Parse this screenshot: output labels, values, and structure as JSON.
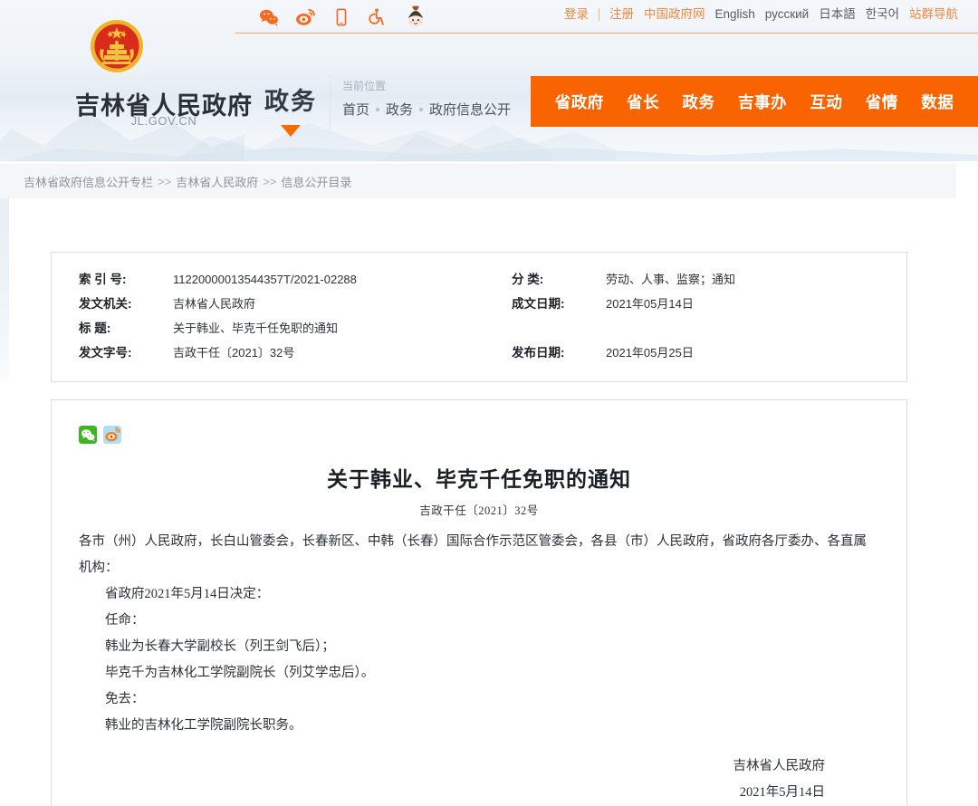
{
  "header": {
    "social_icons": [
      {
        "name": "wechat-icon",
        "label": "微信"
      },
      {
        "name": "weibo-icon",
        "label": "微博"
      },
      {
        "name": "mobile-icon",
        "label": "手机版"
      },
      {
        "name": "accessibility-icon",
        "label": "无障碍"
      },
      {
        "name": "mascot-avatar-icon",
        "label": "吉祥物"
      }
    ],
    "top_links": [
      {
        "label": "登录",
        "style": "orange"
      },
      {
        "label": "注册",
        "style": "orange"
      },
      {
        "label": "中国政府网",
        "style": "orange"
      },
      {
        "label": "English",
        "style": "dark"
      },
      {
        "label": "русский",
        "style": "dark"
      },
      {
        "label": "日本語",
        "style": "dark"
      },
      {
        "label": "한국어",
        "style": "dark"
      },
      {
        "label": "站群导航",
        "style": "orange"
      }
    ],
    "emblem_name": "national-emblem-icon",
    "site_title": "吉林省人民政府",
    "site_url": "JL.GOV.CN",
    "channel": "政务",
    "location_label": "当前位置",
    "location_path": [
      "首页",
      "政务",
      "政府信息公开"
    ],
    "main_nav": [
      "省政府",
      "省长",
      "政务",
      "吉事办",
      "互动",
      "省情",
      "数据"
    ]
  },
  "breadcrumb": {
    "items": [
      "吉林省政府信息公开专栏",
      "吉林省人民政府",
      "信息公开目录"
    ],
    "separator": ">>"
  },
  "meta": {
    "left": [
      {
        "key": "索 引 号:",
        "value": "11220000013544357T/2021-02288",
        "spaced": false
      },
      {
        "key": "发文机关:",
        "value": "吉林省人民政府",
        "spaced": false
      },
      {
        "key": "标    题:",
        "value": "关于韩业、毕克千任免职的通知",
        "spaced": false
      },
      {
        "key": "发文字号:",
        "value": "吉政干任〔2021〕32号",
        "spaced": false
      }
    ],
    "right": [
      {
        "key": "分  类:",
        "value": "劳动、人事、监察；通知",
        "spaced": false
      },
      {
        "key": "成文日期:",
        "value": "2021年05月14日",
        "spaced": false
      },
      {
        "key": "",
        "value": "",
        "spaced": false
      },
      {
        "key": "发布日期:",
        "value": "2021年05月25日",
        "spaced": false
      }
    ]
  },
  "document": {
    "share_icons": [
      {
        "name": "wechat-share-icon",
        "label": "分享到微信"
      },
      {
        "name": "weibo-share-icon",
        "label": "分享到微博"
      }
    ],
    "title": "关于韩业、毕克千任免职的通知",
    "number": "吉政干任〔2021〕32号",
    "paragraphs": [
      {
        "text": "各市（州）人民政府，长白山管委会，长春新区、中韩（长春）国际合作示范区管委会，各县（市）人民政府，省政府各厅委办、各直属机构：",
        "indent": false
      },
      {
        "text": "省政府2021年5月14日决定：",
        "indent": true
      },
      {
        "text": "任命：",
        "indent": true
      },
      {
        "text": "韩业为长春大学副校长（列王剑飞后）；",
        "indent": true
      },
      {
        "text": "毕克千为吉林化工学院副院长（列艾学忠后）。",
        "indent": true
      },
      {
        "text": "免去：",
        "indent": true
      },
      {
        "text": "韩业的吉林化工学院副院长职务。",
        "indent": true
      }
    ],
    "signature_org": "吉林省人民政府",
    "signature_date": "2021年5月14日"
  },
  "colors": {
    "accent_orange": "#fa6400",
    "link_orange": "#f08a3c",
    "text_dark": "#2b3138",
    "bar_gray": "#f4f6f8"
  }
}
